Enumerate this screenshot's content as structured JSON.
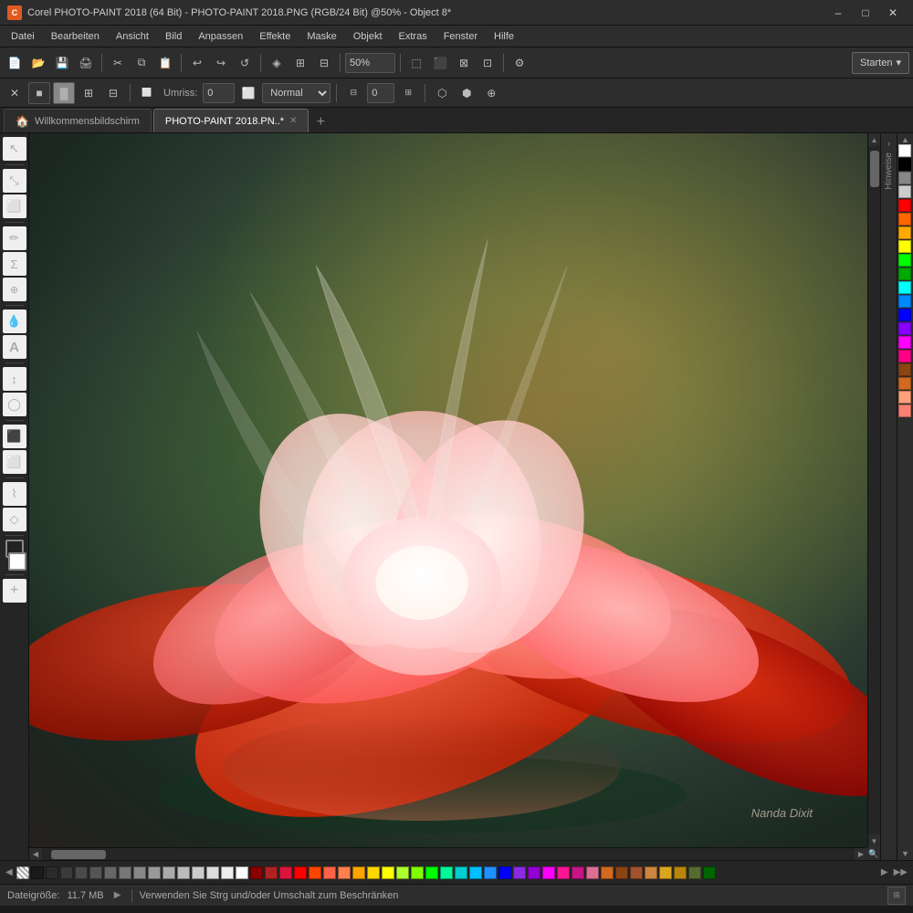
{
  "titlebar": {
    "icon_label": "C",
    "title": "Corel PHOTO-PAINT 2018 (64 Bit) - PHOTO-PAINT 2018.PNG (RGB/24 Bit) @50% - Object 8*",
    "min_btn": "–",
    "max_btn": "□",
    "close_btn": "✕"
  },
  "menubar": {
    "items": [
      "Datei",
      "Bearbeiten",
      "Ansicht",
      "Bild",
      "Anpassen",
      "Effekte",
      "Maske",
      "Objekt",
      "Extras",
      "Fenster",
      "Hilfe"
    ]
  },
  "toolbar1": {
    "zoom_value": "50%",
    "start_label": "Starten",
    "gear_icon": "⚙",
    "dropdown_arrow": "▾"
  },
  "toolbar2": {
    "outline_label": "Umriss:",
    "outline_value": "0",
    "blend_mode": "Normal",
    "opacity_value": "0"
  },
  "tabs": {
    "home_tab_label": "Willkommensbildschirm",
    "file_tab_label": "PHOTO-PAINT 2018.PN..*",
    "add_tab_label": "+"
  },
  "canvas": {
    "watermark": "Nanda Dixit"
  },
  "palette_colors": [
    "#ffffff",
    "#000000",
    "#888888",
    "#cccccc",
    "#ff0000",
    "#ff6600",
    "#ffaa00",
    "#ffff00",
    "#00ff00",
    "#00aa00",
    "#00ffff",
    "#0088ff",
    "#0000ff",
    "#8800ff",
    "#ff00ff",
    "#ff0088",
    "#8b4513",
    "#d2691e",
    "#ffa07a",
    "#fa8072"
  ],
  "bottom_colors": [
    "#1a1a1a",
    "#2a2a2a",
    "#3a3a3a",
    "#4a4a4a",
    "#555555",
    "#666666",
    "#777777",
    "#888888",
    "#999999",
    "#aaaaaa",
    "#bbbbbb",
    "#cccccc",
    "#dddddd",
    "#eeeeee",
    "#ffffff",
    "#8b0000",
    "#b22222",
    "#dc143c",
    "#ff0000",
    "#ff4500",
    "#ff6347",
    "#ff7f50",
    "#ffa500",
    "#ffd700",
    "#ffff00",
    "#adff2f",
    "#7fff00",
    "#00ff00",
    "#00fa9a",
    "#00ced1",
    "#00bfff",
    "#1e90ff",
    "#0000ff",
    "#8a2be2",
    "#9400d3",
    "#ff00ff",
    "#ff1493",
    "#c71585",
    "#db7093",
    "#d2691e",
    "#8b4513",
    "#a0522d",
    "#cd853f",
    "#daa520",
    "#b8860b",
    "#556b2f",
    "#006400"
  ],
  "status": {
    "file_size_label": "Dateigröße:",
    "file_size_value": "11.7 MB",
    "hint_text": "Verwenden Sie Strg und/oder Umschalt zum Beschränken"
  },
  "left_tools": [
    {
      "name": "select",
      "icon": "↖",
      "title": "Auswahl"
    },
    {
      "name": "transform",
      "icon": "⤡",
      "title": "Transformieren"
    },
    {
      "name": "crop",
      "icon": "⬜",
      "title": "Freistellen"
    },
    {
      "name": "paint",
      "icon": "✏",
      "title": "Malen"
    },
    {
      "name": "zoom",
      "icon": "🔍",
      "title": "Zoom"
    },
    {
      "name": "eyedrop",
      "icon": "💧",
      "title": "Pipette"
    },
    {
      "name": "fill",
      "icon": "Σ",
      "title": "Füllen"
    },
    {
      "name": "text",
      "icon": "A",
      "title": "Text"
    },
    {
      "name": "brush",
      "icon": "↕",
      "title": "Pinsel"
    },
    {
      "name": "eraser",
      "icon": "◯",
      "title": "Radiergummi"
    },
    {
      "name": "stamp",
      "icon": "⬛",
      "title": "Stempel"
    },
    {
      "name": "rect",
      "icon": "⬜",
      "title": "Rechteck"
    },
    {
      "name": "retouch",
      "icon": "⌇",
      "title": "Retusche"
    },
    {
      "name": "dodge",
      "icon": "◇",
      "title": "Dodge"
    },
    {
      "name": "colors",
      "icon": "⬛",
      "title": "Farben"
    },
    {
      "name": "add",
      "icon": "+",
      "title": "Hinzufügen"
    }
  ]
}
